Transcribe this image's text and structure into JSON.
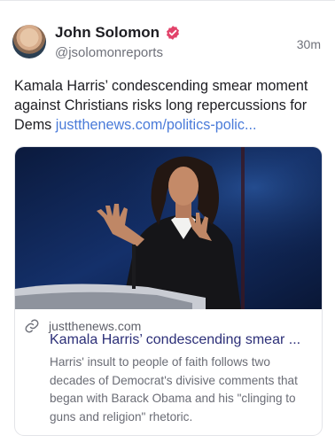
{
  "post": {
    "author_name": "John Solomon",
    "handle": "@jsolomonreports",
    "time": "30m",
    "text": "Kamala Harris’ condescending smear moment against Christians risks long repercussions for Dems",
    "link_text": "justthenews.com/politics-polic..."
  },
  "card": {
    "domain": "justthenews.com",
    "title": "Kamala Harris’ condescending smear ...",
    "description": "Harris' insult to people of faith follows two decades of Democrat's divisive comments that began with Barack Obama and his \"clinging to guns and religion\" rhetoric."
  },
  "colors": {
    "link": "#4a7bd9",
    "verified_badge": "#e2436a",
    "card_title": "#2c2f78"
  },
  "icons": [
    "verified-icon",
    "link-icon"
  ]
}
